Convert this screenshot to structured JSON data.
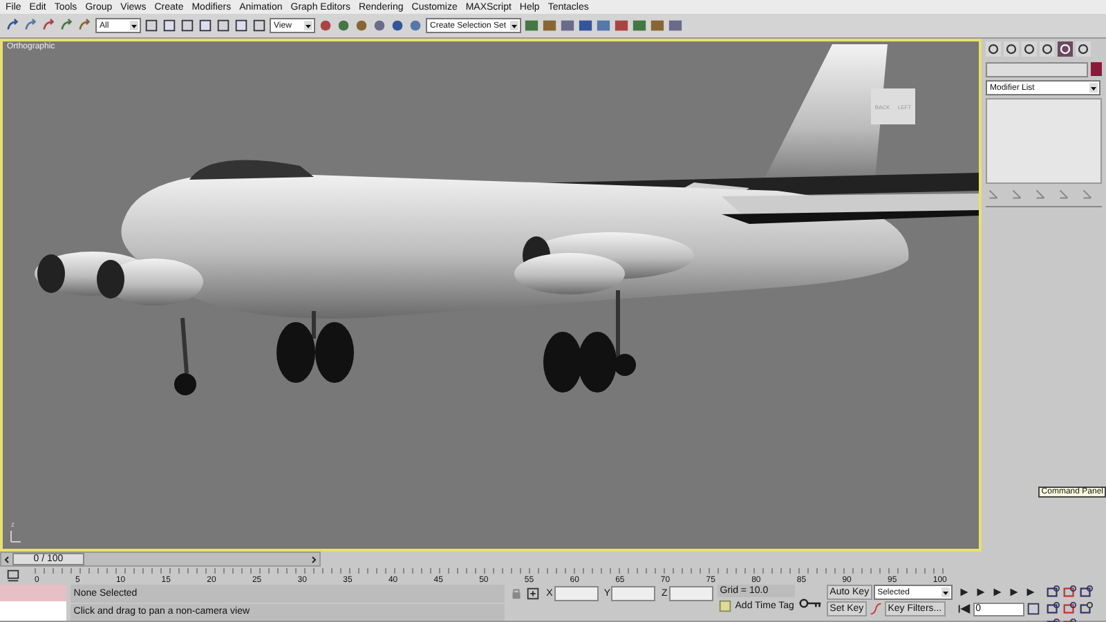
{
  "menu_bar": [
    "File",
    "Edit",
    "Tools",
    "Group",
    "Views",
    "Create",
    "Modifiers",
    "Animation",
    "Graph Editors",
    "Rendering",
    "Customize",
    "MAXScript",
    "Help",
    "Tentacles"
  ],
  "toolbar": {
    "selection_filter": "All",
    "reference_coordinate_system": "View",
    "named_selection_set": "Create Selection Set"
  },
  "viewport": {
    "label": "Orthographic",
    "viewcube_faces": [
      "BACK",
      "LEFT"
    ],
    "axis_label": "z",
    "active": true
  },
  "command_panel": {
    "tabs": [
      {
        "selected": false
      },
      {
        "selected": false
      },
      {
        "selected": false
      },
      {
        "selected": false
      },
      {
        "selected": true
      },
      {
        "selected": false
      }
    ],
    "modifier_list": "Modifier List",
    "tooltip": "Command Panel"
  },
  "time_slider": {
    "frame": "0 / 100",
    "level": 0
  },
  "track_bar": {
    "ticks": [
      "0",
      "5",
      "10",
      "15",
      "20",
      "25",
      "30",
      "35",
      "40",
      "45",
      "50",
      "55",
      "60",
      "65",
      "70",
      "75",
      "80",
      "85",
      "90",
      "95",
      "100"
    ]
  },
  "status_bar": {
    "selection": "None Selected",
    "prompt": "Click and drag to pan a non-camera view",
    "coordinates": [
      "X",
      "Y",
      "Z"
    ],
    "grid": "Grid = 10.0",
    "add_time_tag": "Add Time Tag"
  },
  "animation_controls": {
    "auto_key": "Auto Key",
    "key_mode": "Selected",
    "set_key": "Set Key",
    "key_filters": "Key Filters...",
    "current_frame": "0"
  }
}
